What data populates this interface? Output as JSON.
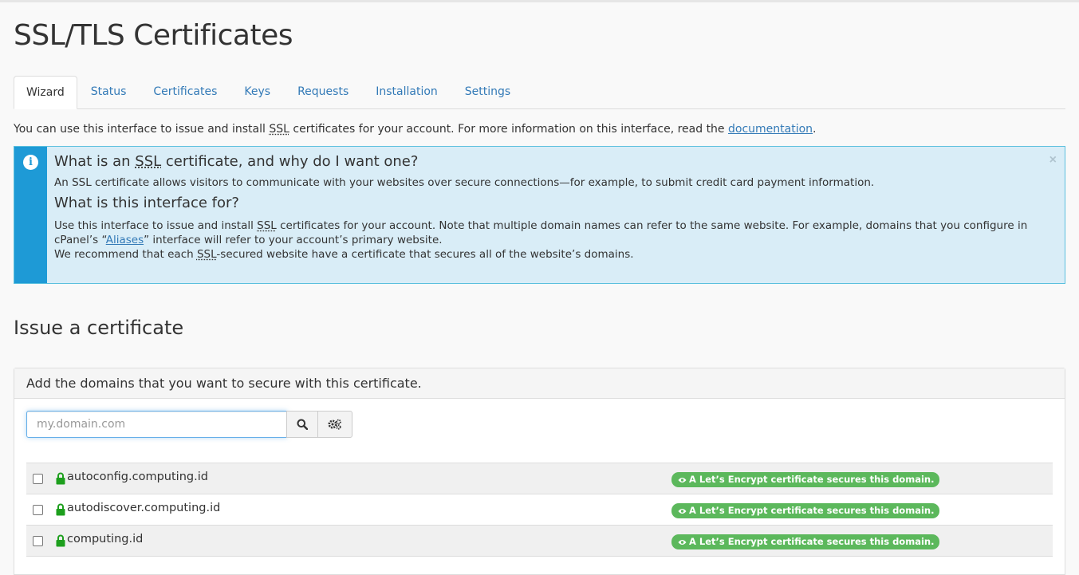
{
  "page": {
    "title": "SSL/TLS Certificates"
  },
  "tabs": [
    {
      "label": "Wizard",
      "active": true
    },
    {
      "label": "Status"
    },
    {
      "label": "Certificates"
    },
    {
      "label": "Keys"
    },
    {
      "label": "Requests"
    },
    {
      "label": "Installation"
    },
    {
      "label": "Settings"
    }
  ],
  "intro": {
    "before": "You can use this interface to issue and install ",
    "ssl": "SSL",
    "middle": " certificates for your account. For more information on this interface, read the ",
    "link": "documentation",
    "after": "."
  },
  "alert": {
    "heading1_before": "What is an ",
    "heading1_ssl": "SSL",
    "heading1_after": " certificate, and why do I want one?",
    "text1": "An SSL certificate allows visitors to communicate with your websites over secure connections—for example, to submit credit card payment information.",
    "heading2": "What is this interface for?",
    "text2_a": "Use this interface to issue and install ",
    "text2_ssl": "SSL",
    "text2_b": " certificates for your account. Note that multiple domain names can refer to the same website. For example, domains that you configure in cPanel’s “",
    "text2_link": "Aliases",
    "text2_c": "” interface will refer to your account’s primary website.",
    "text3_a": "We recommend that each ",
    "text3_ssl": "SSL",
    "text3_b": "-secured website have a certificate that secures all of the website’s domains.",
    "close": "×"
  },
  "section": {
    "title": "Issue a certificate"
  },
  "panel": {
    "heading": "Add the domains that you want to secure with this certificate.",
    "search_placeholder": "my.domain.com"
  },
  "domains": [
    {
      "name": "autoconfig.computing.id",
      "status": "A Let’s Encrypt certificate secures this domain."
    },
    {
      "name": "autodiscover.computing.id",
      "status": "A Let’s Encrypt certificate secures this domain."
    },
    {
      "name": "computing.id",
      "status": "A Let’s Encrypt certificate secures this domain."
    }
  ],
  "colors": {
    "link": "#337ab7",
    "alert_bg": "#d9edf7",
    "alert_side": "#1e9ad6",
    "badge_green": "#5cb85c",
    "lock_green": "#1d9f1d"
  },
  "icons": {
    "info": "info-icon",
    "search": "search-icon",
    "settings": "gears-icon",
    "lock": "lock-icon",
    "eye": "eye-icon",
    "close": "close-icon"
  }
}
